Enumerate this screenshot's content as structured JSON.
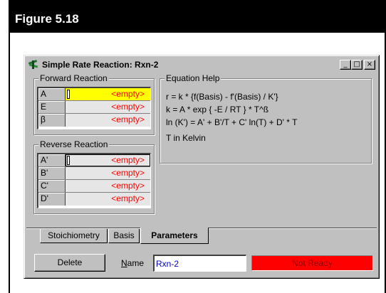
{
  "figure": {
    "title": "Figure 5.18"
  },
  "window": {
    "title": "Simple Rate Reaction: Rxn-2",
    "controls": {
      "minimize": "_",
      "maximize": "□",
      "close": "×"
    }
  },
  "forward": {
    "label": "Forward Reaction",
    "rows": [
      {
        "name": "A",
        "value": "<empty>"
      },
      {
        "name": "E",
        "value": "<empty>"
      },
      {
        "name": "β",
        "value": "<empty>"
      }
    ]
  },
  "reverse": {
    "label": "Reverse Reaction",
    "rows": [
      {
        "name": "A'",
        "value": "<empty>"
      },
      {
        "name": "B'",
        "value": "<empty>"
      },
      {
        "name": "C'",
        "value": "<empty>"
      },
      {
        "name": "D'",
        "value": "<empty>"
      }
    ]
  },
  "help": {
    "label": "Equation Help",
    "lines": [
      "r  =  k * {f(Basis) - f'(Basis) / K'}",
      "k  =  A * exp { -E / RT } * T^ß",
      "ln (K')  =  A' + B'/T + C' ln(T) + D' * T",
      "T in Kelvin"
    ]
  },
  "tabs": [
    "Stoichiometry",
    "Basis",
    "Parameters"
  ],
  "active_tab": "Parameters",
  "footer": {
    "delete_label": "Delete",
    "name_label": "Name",
    "name_value": "Rxn-2",
    "status": "Not Ready"
  },
  "colors": {
    "selected_cell": "#ffff00",
    "empty_text": "#ff0000",
    "status_bg": "#ff0000"
  }
}
